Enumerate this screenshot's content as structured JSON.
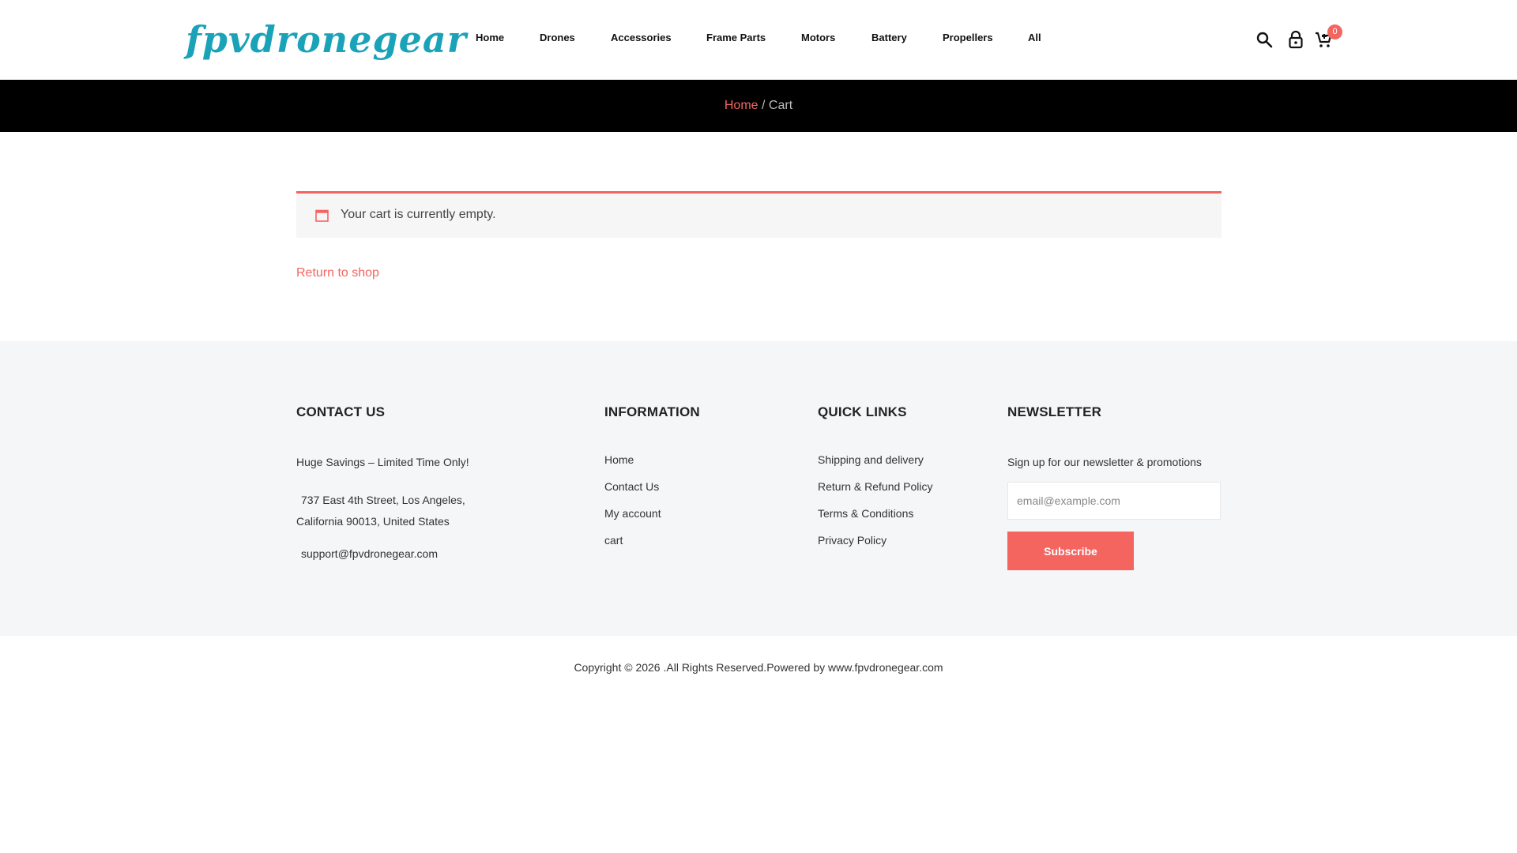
{
  "brand": {
    "logo_text": "fpvdronegear"
  },
  "nav": {
    "items": [
      {
        "label": "Home"
      },
      {
        "label": "Drones"
      },
      {
        "label": "Accessories"
      },
      {
        "label": "Frame Parts"
      },
      {
        "label": "Motors"
      },
      {
        "label": "Battery"
      },
      {
        "label": "Propellers"
      },
      {
        "label": "All"
      }
    ]
  },
  "header_icons": {
    "search": "search-icon",
    "account": "lock-icon",
    "cart": "cart-icon",
    "cart_count": "0"
  },
  "breadcrumb": {
    "home": "Home",
    "separator": "/",
    "current": "Cart"
  },
  "cart": {
    "notice": "Your cart is currently empty.",
    "notice_icon": "calendar-icon",
    "return_link": "Return to shop"
  },
  "footer": {
    "contact": {
      "title": "CONTACT US",
      "tagline": "Huge Savings – Limited Time Only!",
      "address_line1": "737 East 4th Street, Los Angeles,",
      "address_line2": "California 90013, United States",
      "email": "support@fpvdronegear.com"
    },
    "information": {
      "title": "INFORMATION",
      "links": [
        "Home",
        "Contact Us",
        "My account",
        "cart"
      ]
    },
    "quick_links": {
      "title": "QUICK LINKS",
      "links": [
        "Shipping and delivery",
        "Return & Refund Policy",
        "Terms & Conditions",
        "Privacy Policy"
      ]
    },
    "newsletter": {
      "title": "NEWSLETTER",
      "text": "Sign up for our newsletter & promotions",
      "placeholder": "email@example.com",
      "button": "Subscribe"
    }
  },
  "copyright": "Copyright © 2026 .All Rights Reserved.Powered by www.fpvdronegear.com",
  "colors": {
    "accent": "#f46560",
    "logo": "#1aa3b8",
    "banner": "#000000",
    "footer_bg": "#f5f6f8"
  }
}
